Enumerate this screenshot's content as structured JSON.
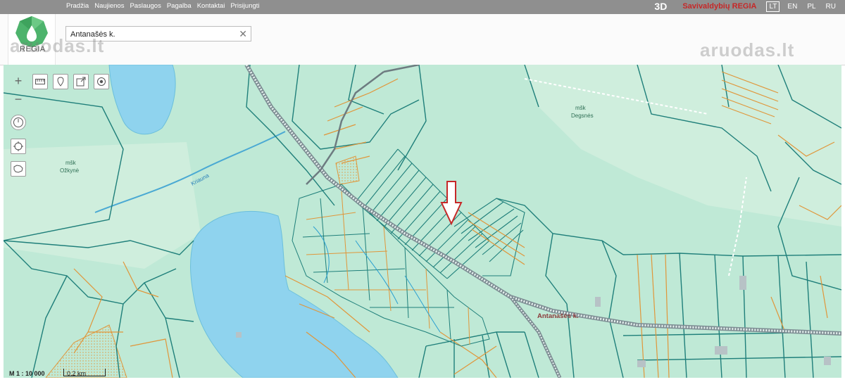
{
  "nav": {
    "items": [
      "Pradžia",
      "Naujienos",
      "Paslaugos",
      "Pagalba",
      "Kontaktai",
      "Prisijungti"
    ]
  },
  "header_right": {
    "btn_3d": "3D",
    "regia_label": "Savivaldybių REGIA",
    "languages": [
      "LT",
      "EN",
      "PL",
      "RU"
    ],
    "active_language": "LT"
  },
  "logo": {
    "text": "REGIA"
  },
  "search": {
    "value": "Antanašės k.",
    "clear_symbol": "✕"
  },
  "watermark": {
    "text": "aruodas.lt"
  },
  "map": {
    "labels": {
      "forest_ozkyne_1": "mšk",
      "forest_ozkyne_2": "Ožkynė",
      "forest_degsnes_1": "mšk",
      "forest_degsnes_2": "Degsnės",
      "river": "Kriauna",
      "village": "Antanašės k."
    },
    "scale": {
      "ratio": "M 1 : 10 000",
      "distance": "0.2 km"
    },
    "colors": {
      "land": "#bfe9d6",
      "meadow": "#cfeedd",
      "water": "#8fd3ee",
      "parcel_teal": "#1f7f7a",
      "parcel_orange": "#e0963a",
      "road": "#7d8d93",
      "marker": "#c62828"
    }
  },
  "tools": {
    "zoom_in": "+",
    "zoom_out": "−"
  }
}
